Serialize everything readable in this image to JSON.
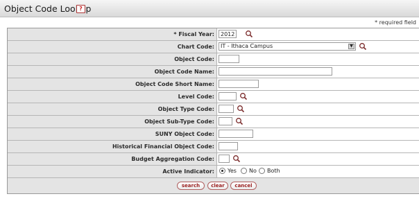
{
  "header": {
    "title": "Object Code Lookup",
    "help_icon": "help-icon"
  },
  "required_note": "* required field",
  "fields": {
    "fiscal_year": {
      "label": "* Fiscal Year:",
      "value": "2012"
    },
    "chart_code": {
      "label": "Chart Code:",
      "value": "IT - Ithaca Campus"
    },
    "object_code": {
      "label": "Object Code:",
      "value": ""
    },
    "object_code_name": {
      "label": "Object Code Name:",
      "value": ""
    },
    "object_code_short_name": {
      "label": "Object Code Short Name:",
      "value": ""
    },
    "level_code": {
      "label": "Level Code:",
      "value": ""
    },
    "object_type_code": {
      "label": "Object Type Code:",
      "value": ""
    },
    "object_sub_type_code": {
      "label": "Object Sub-Type Code:",
      "value": ""
    },
    "suny_object_code": {
      "label": "SUNY Object Code:",
      "value": ""
    },
    "historical_financial_object_code": {
      "label": "Historical Financial Object Code:",
      "value": ""
    },
    "budget_aggregation_code": {
      "label": "Budget Aggregation Code:",
      "value": ""
    },
    "active_indicator": {
      "label": "Active Indicator:",
      "options": [
        "Yes",
        "No",
        "Both"
      ],
      "selected": "Yes"
    }
  },
  "buttons": {
    "search": "search",
    "clear": "clear",
    "cancel": "cancel"
  },
  "colors": {
    "label_bg": "#e4e4e4",
    "button_text": "#9a1c1c"
  }
}
